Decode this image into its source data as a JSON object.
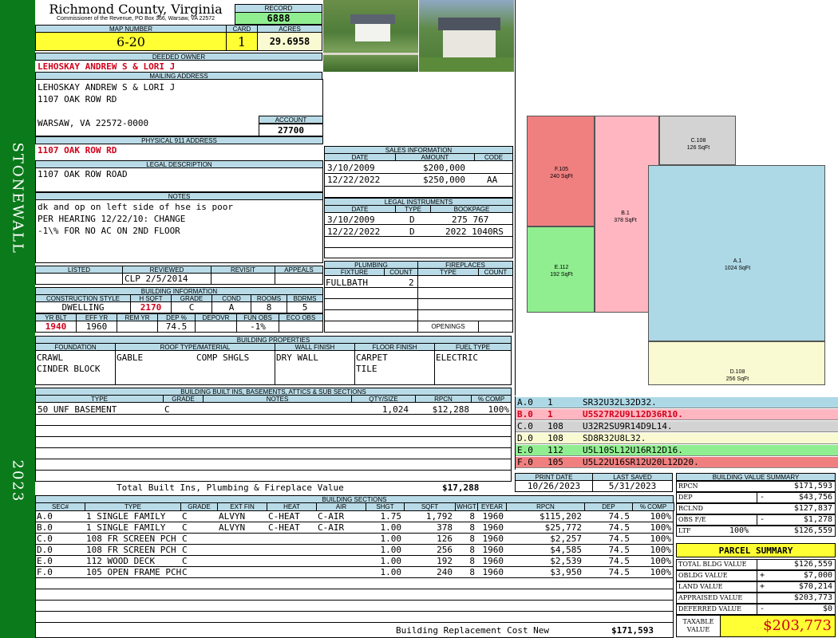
{
  "header": {
    "county": "Richmond County, Virginia",
    "commissioner": "Commissioner of the Revenue, PO Box 366, Warsaw, VA 22572",
    "record_label": "RECORD",
    "record": "6888",
    "map_number_label": "MAP NUMBER",
    "map_number": "6-20",
    "card_label": "CARD",
    "card": "1",
    "acres_label": "ACRES",
    "acres": "29.6958"
  },
  "sidebar": {
    "district": "STONEWALL",
    "year": "2023"
  },
  "owner": {
    "deeded_owner_label": "DEEDED OWNER",
    "deeded_owner": "LEHOSKAY ANDREW S & LORI J",
    "mailing_label": "MAILING ADDRESS",
    "mailing_line1": "LEHOSKAY ANDREW S & LORI J",
    "mailing_line2": "1107 OAK ROW RD",
    "mailing_line3": "WARSAW, VA 22572-0000",
    "account_label": "ACCOUNT",
    "account": "27700",
    "physical_label": "PHYSICAL 911 ADDRESS",
    "physical": "1107 OAK ROW RD",
    "legal_label": "LEGAL DESCRIPTION",
    "legal": "1107 OAK ROW ROAD",
    "notes_label": "NOTES",
    "notes": [
      "dk and op on left side of hse is poor",
      "PER HEARING 12/22/10: CHANGE",
      "-1\\% FOR NO AC ON 2ND FLOOR"
    ]
  },
  "sales": {
    "title": "SALES INFORMATION",
    "cols": [
      "DATE",
      "AMOUNT",
      "CODE"
    ],
    "rows": [
      [
        "3/10/2009",
        "$200,000",
        ""
      ],
      [
        "12/22/2022",
        "$250,000",
        "AA"
      ]
    ]
  },
  "legal_instruments": {
    "title": "LEGAL INSTRUMENTS",
    "cols": [
      "DATE",
      "TYPE",
      "BOOKPAGE"
    ],
    "rows": [
      [
        "3/10/2009",
        "D",
        "275 767"
      ],
      [
        "12/22/2022",
        "D",
        "2022 1040RS"
      ]
    ]
  },
  "review": {
    "cols": [
      "LISTED",
      "REVIEWED",
      "REVISIT",
      "APPEALS"
    ],
    "listed": "",
    "reviewed": "CLP   2/5/2014",
    "revisit": "",
    "appeals": ""
  },
  "building_info": {
    "title": "BUILDING INFORMATION",
    "cols": [
      "CONSTRUCTION STYLE",
      "H SQFT",
      "GRADE",
      "COND",
      "ROOMS",
      "BDRMS"
    ],
    "values": [
      "DWELLING",
      "2170",
      "C",
      "A",
      "8",
      "5"
    ],
    "cols2": [
      "YR BLT",
      "EFF YR",
      "REM YR",
      "DEP %",
      "DEPOVR",
      "FUN OBS",
      "ECO OBS"
    ],
    "values2": [
      "1940",
      "1960",
      "",
      "74.5",
      "",
      "-1%",
      ""
    ]
  },
  "plumbing": {
    "title": "PLUMBING",
    "cols": [
      "FIXTURE",
      "COUNT"
    ],
    "rows": [
      [
        "FULLBATH",
        "2"
      ]
    ]
  },
  "fireplaces": {
    "title": "FIREPLACES",
    "cols": [
      "TYPE",
      "COUNT"
    ],
    "openings_label": "OPENINGS"
  },
  "properties": {
    "title": "BUILDING PROPERTIES",
    "cols": [
      "FOUNDATION",
      "ROOF TYPE/MATERIAL",
      "WALL FINISH",
      "FLOOR FINISH",
      "FUEL TYPE"
    ],
    "foundation": [
      "CRAWL",
      "CINDER BLOCK"
    ],
    "roof_type": "GABLE",
    "roof_material": "COMP SHGLS",
    "wall": "DRY WALL",
    "floor": [
      "CARPET",
      "TILE"
    ],
    "fuel": "ELECTRIC"
  },
  "builtins": {
    "title": "BUILDING BUILT INS, BASEMENTS, ATTICS & SUB SECTIONS",
    "cols": [
      "TYPE",
      "GRADE",
      "NOTES",
      "QTY/SIZE",
      "RPCN",
      "% COMP"
    ],
    "rows": [
      [
        "50 UNF BASEMENT",
        "C",
        "",
        "1,024",
        "$12,288",
        "100%"
      ]
    ],
    "total_label": "Total Built Ins, Plumbing & Fireplace Value",
    "total": "$17,288"
  },
  "print": {
    "print_label": "PRINT DATE",
    "print_date": "10/26/2023",
    "saved_label": "LAST SAVED",
    "saved_date": "5/31/2023"
  },
  "sections": {
    "title": "BUILDING SECTIONS",
    "cols": [
      "SEC#",
      "TYPE",
      "GRADE",
      "EXT FIN",
      "HEAT",
      "AIR",
      "SHGT",
      "SQFT",
      "WHGT",
      "EYEAR",
      "RPCN",
      "DEP",
      "% COMP"
    ],
    "rows": [
      [
        "A.0",
        "1 SINGLE FAMILY",
        "C",
        "ALVYN",
        "C-HEAT",
        "C-AIR",
        "1.75",
        "1,792",
        "8",
        "1960",
        "$115,202",
        "74.5",
        "100%"
      ],
      [
        "B.0",
        "1 SINGLE FAMILY",
        "C",
        "ALVYN",
        "C-HEAT",
        "C-AIR",
        "1.00",
        "378",
        "8",
        "1960",
        "$25,772",
        "74.5",
        "100%"
      ],
      [
        "C.0",
        "108 FR SCREEN PCH",
        "C",
        "",
        "",
        "",
        "1.00",
        "126",
        "8",
        "1960",
        "$2,257",
        "74.5",
        "100%"
      ],
      [
        "D.0",
        "108 FR SCREEN PCH",
        "C",
        "",
        "",
        "",
        "1.00",
        "256",
        "8",
        "1960",
        "$4,585",
        "74.5",
        "100%"
      ],
      [
        "E.0",
        "112 WOOD DECK",
        "C",
        "",
        "",
        "",
        "1.00",
        "192",
        "8",
        "1960",
        "$2,539",
        "74.5",
        "100%"
      ],
      [
        "F.0",
        "105 OPEN FRAME PCH",
        "C",
        "",
        "",
        "",
        "1.00",
        "240",
        "8",
        "1960",
        "$3,950",
        "74.5",
        "100%"
      ]
    ],
    "total_label": "Building Replacement Cost New",
    "total": "$171,593"
  },
  "sketch": {
    "labels": [
      "F.105\n240 SqFt",
      "B.1\n378 SqFt",
      "C.108\n126 SqFt",
      "A.1\n1024 SqFt",
      "E.112\n192 SqFt",
      "D.108\n256 SqFt"
    ],
    "colors": {
      "A": "#add8e6",
      "B": "#ffb6c1",
      "C": "#d3d3d3",
      "D": "#fafad2",
      "E": "#90ee90",
      "F": "#f08080"
    }
  },
  "vectors": [
    {
      "sec": "A.0",
      "code": "1",
      "vec": "SR32U32L32D32.",
      "color": "#add8e6"
    },
    {
      "sec": "B.0",
      "code": "1",
      "vec": "U5S27R2U9L12D36R10.",
      "color": "#ffb6c1"
    },
    {
      "sec": "C.0",
      "code": "108",
      "vec": "U32R2SU9R14D9L14.",
      "color": "#d3d3d3"
    },
    {
      "sec": "D.0",
      "code": "108",
      "vec": "SD8R32U8L32.",
      "color": "#fafad2"
    },
    {
      "sec": "E.0",
      "code": "112",
      "vec": "U5L10SL12U16R12D16.",
      "color": "#90ee90"
    },
    {
      "sec": "F.0",
      "code": "105",
      "vec": "U5L22U16SR12U20L12D20.",
      "color": "#f08080"
    }
  ],
  "value_summary": {
    "title": "BUILDING VALUE SUMMARY",
    "rpcn": "$171,593",
    "dep": "$43,756",
    "rclnd": "$127,837",
    "obs": "$1,278",
    "ltr_pct": "100%",
    "ltr": "$126,559",
    "labels": [
      "RPCN",
      "DEP",
      "RCLND",
      "OBS F/E",
      "LTF"
    ]
  },
  "parcel": {
    "title": "PARCEL SUMMARY",
    "total_bldg_label": "TOTAL BLDG VALUE",
    "total_bldg": "$126,559",
    "obldg_label": "OBLDG VALUE",
    "obldg": "$7,000",
    "land_label": "LAND VALUE",
    "land": "$70,214",
    "appraised_label": "APPRAISED VALUE",
    "appraised": "$203,773",
    "deferred_label": "DEFERRED VALUE",
    "deferred": "$0",
    "taxable_label": "TAXABLE VALUE",
    "taxable": "$203,773"
  }
}
